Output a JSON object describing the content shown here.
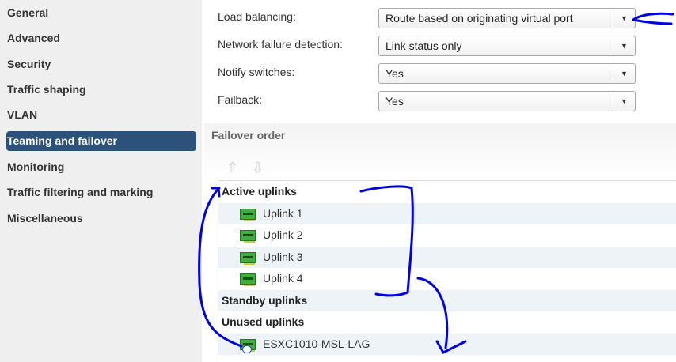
{
  "sidebar": {
    "items": [
      {
        "label": "General"
      },
      {
        "label": "Advanced"
      },
      {
        "label": "Security"
      },
      {
        "label": "Traffic shaping"
      },
      {
        "label": "VLAN"
      },
      {
        "label": "Teaming and failover",
        "selected": true
      },
      {
        "label": "Monitoring"
      },
      {
        "label": "Traffic filtering and marking"
      },
      {
        "label": "Miscellaneous"
      }
    ]
  },
  "settings": [
    {
      "label": "Load balancing:",
      "value": "Route based on originating virtual port"
    },
    {
      "label": "Network failure detection:",
      "value": "Link status only"
    },
    {
      "label": "Notify switches:",
      "value": "Yes"
    },
    {
      "label": "Failback:",
      "value": "Yes"
    }
  ],
  "failover": {
    "title": "Failover order",
    "move_up_icon": "arrow-up-icon",
    "move_down_icon": "arrow-down-icon",
    "active_label": "Active uplinks",
    "active": [
      "Uplink 1",
      "Uplink 2",
      "Uplink 3",
      "Uplink 4"
    ],
    "standby_label": "Standby uplinks",
    "unused_label": "Unused uplinks",
    "unused": [
      "ESXC1010-MSL-LAG"
    ]
  },
  "colors": {
    "selected": "#2c527c",
    "annotation": "#0000e6"
  }
}
